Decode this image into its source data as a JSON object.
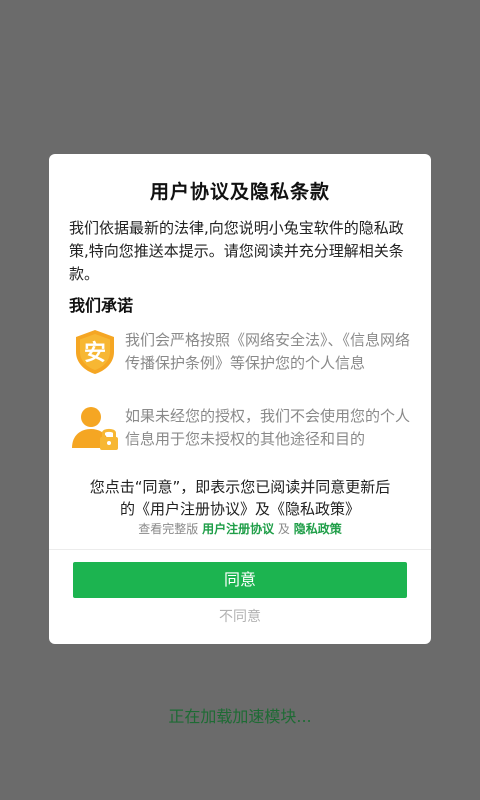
{
  "dialog": {
    "title": "用户协议及隐私条款",
    "intro": "我们依据最新的法律,向您说明小兔宝软件的隐私政策,特向您推送本提示。请您阅读并充分理解相关条款。",
    "promise_heading": "我们承诺",
    "promises": [
      {
        "icon": "shield-icon",
        "icon_char": "安",
        "text": "我们会严格按照《网络安全法》、《信息网络传播保护条例》等保护您的个人信息"
      },
      {
        "icon": "user-lock-icon",
        "text": "如果未经您的授权，我们不会使用您的个人信息用于您未授权的其他途径和目的"
      }
    ],
    "notice_line1": "您点击“同意”，即表示您已阅读并同意更新后",
    "notice_line2": "的《用户注册协议》及《隐私政策》",
    "view_full_prefix": "查看完整版",
    "view_full_link1": "用户注册协议",
    "view_full_and": "及",
    "view_full_link2": "隐私政策",
    "agree_label": "同意",
    "disagree_label": "不同意"
  },
  "loading_text": "正在加载加速模块...",
  "colors": {
    "accent": "#1cb450",
    "link": "#1f9e48",
    "icon_orange": "#f5a623",
    "overlay": "#6b6b6b"
  }
}
